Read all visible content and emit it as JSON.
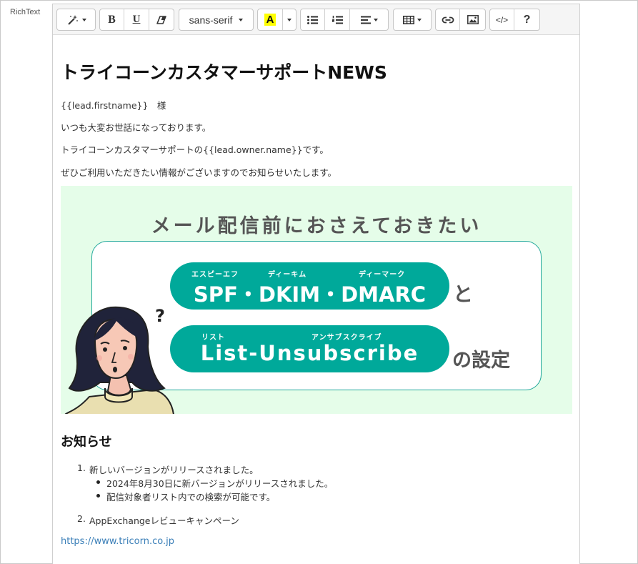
{
  "field_label": "RichText",
  "toolbar": {
    "font_family": "sans-serif",
    "bold": "B",
    "underline": "U",
    "highlight": "A",
    "code": "</>",
    "help": "?"
  },
  "content": {
    "title": "トライコーンカスタマーサポートNEWS",
    "salutation": "{{lead.firstname}}　様",
    "greeting": "いつも大変お世話になっております。",
    "intro": "トライコーンカスタマーサポートの{{lead.owner.name}}です。",
    "notice": "ぜひご利用いただきたい情報がございますのでお知らせいたします。"
  },
  "banner": {
    "heading": "メール配信前におさえておきたい",
    "pill1_text": "SPF・DKIM・DMARC",
    "pill1_ruby_spf": "エスピーエフ",
    "pill1_ruby_dkim": "ディーキム",
    "pill1_ruby_dmarc": "ディーマーク",
    "pill1_suffix": "と",
    "pill2_text": "List-Unsubscribe",
    "pill2_ruby_list": "リスト",
    "pill2_ruby_unsub": "アンサブスクライブ",
    "pill2_suffix": "の設定",
    "question_mark": "?",
    "colors": {
      "background": "#e5fde9",
      "pill": "#00a99a",
      "border": "#21a89b"
    }
  },
  "news": {
    "section_title": "お知らせ",
    "items": [
      {
        "label": "新しいバージョンがリリースされました。",
        "sub_items": [
          "2024年8月30日に新バージョンがリリースされました。",
          "配信対象者リスト内での検索が可能です。"
        ]
      },
      {
        "label": "AppExchangeレビューキャンペーン",
        "sub_items": []
      }
    ]
  },
  "link_url": "https://www.tricorn.co.jp"
}
